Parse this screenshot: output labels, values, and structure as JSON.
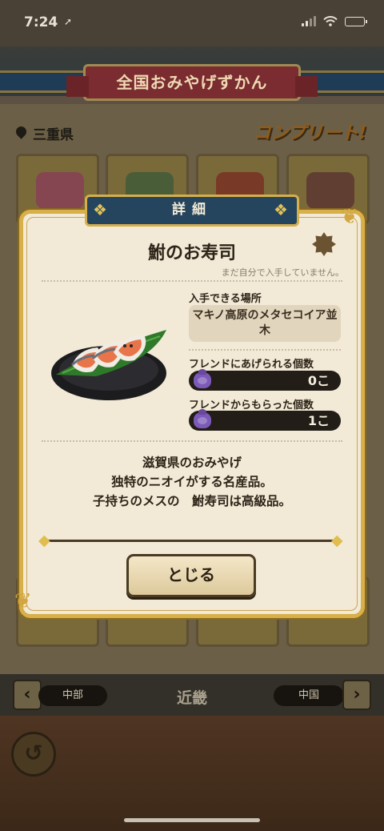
{
  "status_bar": {
    "time": "7:24",
    "icons": [
      "location-arrow-icon",
      "signal-icon",
      "wifi-icon",
      "battery-icon"
    ]
  },
  "background": {
    "title": "全国おみやげずかん",
    "prefecture": "三重県",
    "complete_badge": "コンプリート!",
    "region_nav": {
      "prev_label": "中部",
      "current_label": "近畿",
      "next_label": "中国"
    }
  },
  "dialog": {
    "header": "詳細",
    "item_name": "鮒のお寿司",
    "obtained_status": "まだ自分で入手していません。",
    "location_label": "入手できる場所",
    "location_value": "マキノ高原のメタセコイア並木",
    "give_label": "フレンドにあげられる個数",
    "give_value": "0こ",
    "received_label": "フレンドからもらった個数",
    "received_value": "1こ",
    "description": [
      "滋賀県のおみやげ",
      "独特のニオイがする名産品。",
      "子持ちのメスの　鮒寿司は高級品。"
    ],
    "close_label": "とじる"
  },
  "colors": {
    "dialog_bg": "#f2ead7",
    "dialog_border": "#d8b04a",
    "ribbon": "#25455f",
    "count_bar": "#221d17",
    "bag": "#7c5ab8"
  }
}
